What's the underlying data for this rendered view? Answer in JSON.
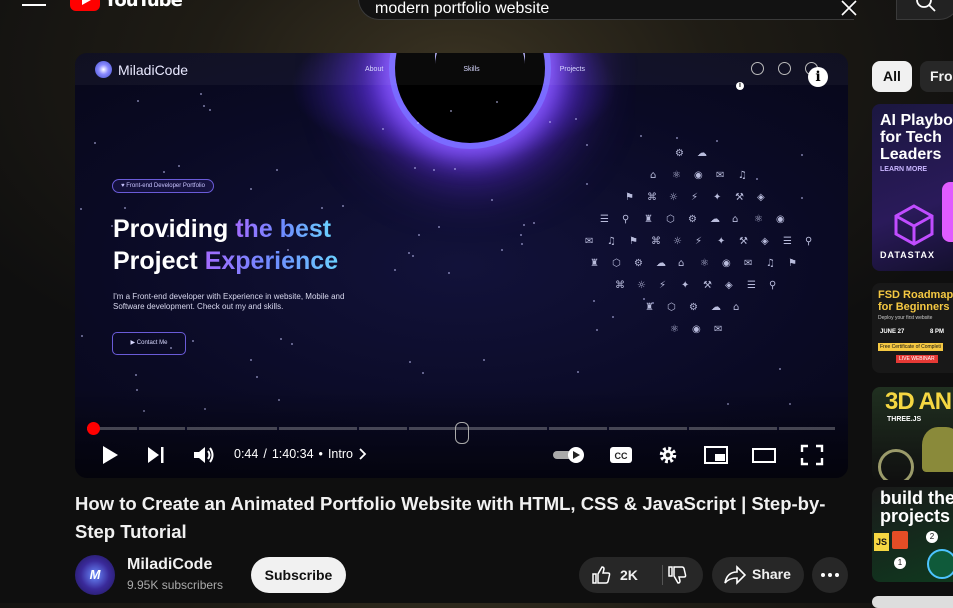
{
  "header": {
    "logo_text": "YouTube",
    "search_value": "modern portfolio website"
  },
  "player": {
    "site": {
      "logo": "MiladiCode",
      "nav": [
        "About",
        "Skills",
        "Projects"
      ],
      "badge": "♥ Front-end Developer Portfolio",
      "hero_line1_plain": "Providing ",
      "hero_line1_grad": "the best",
      "hero_line2_plain": "Project ",
      "hero_line2_grad": "Experience",
      "description": "I'm a Front-end developer with Experience in website, Mobile and Software development. Check out my and skills.",
      "contact_button": "▶ Contact Me"
    },
    "info_icon": "i",
    "time_current": "0:44",
    "time_separator": "/",
    "time_total": "1:40:34",
    "chapter": "Intro",
    "progress_fraction": 0.007
  },
  "video": {
    "title": "How to Create an Animated Portfolio Website with HTML, CSS & JavaScript | Step-by-Step Tutorial",
    "channel_name": "MiladiCode",
    "avatar_text": "M",
    "subscribers": "9.95K subscribers",
    "subscribe_label": "Subscribe",
    "likes": "2K",
    "share_label": "Share"
  },
  "sidebar": {
    "chips": [
      "All",
      "From"
    ],
    "thumbs": [
      {
        "line1": "AI Playbo",
        "line2": "for Tech",
        "line3": "Leaders",
        "cta": "LEARN MORE",
        "brand": "DATASTAX"
      },
      {
        "line1": "FSD Roadmap",
        "line2": "for Beginners",
        "sub": "Deploy your first website",
        "date": "JUNE 27",
        "time": "8 PM",
        "tag1": "Free Certificate of Completi",
        "tag2": "LIVE WEBINAR"
      },
      {
        "line1": "3D AN",
        "sub": "THREE.JS"
      },
      {
        "line1": "build thes",
        "line2": "projects"
      }
    ]
  },
  "colors": {
    "accent_red": "#ff0000",
    "chip_active_bg": "#f1f1f1",
    "pill_bg": "#272727"
  }
}
